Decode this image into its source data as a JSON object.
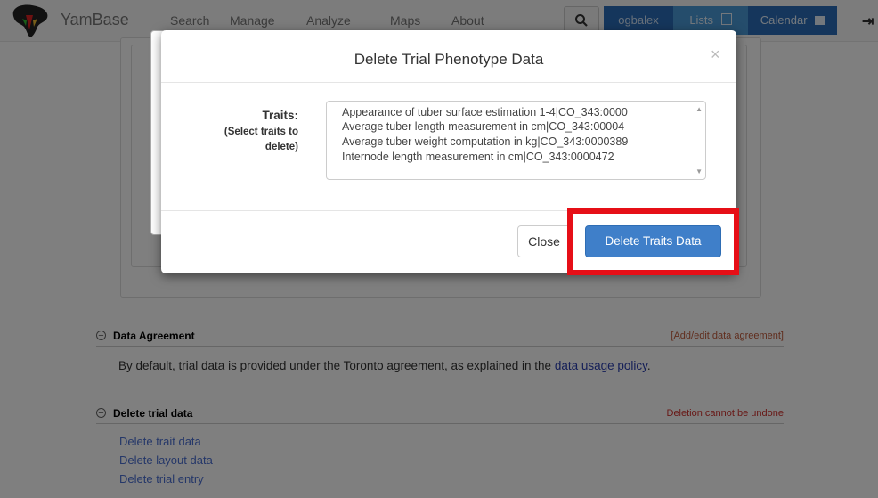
{
  "navbar": {
    "brand": "YamBase",
    "items": [
      "Search",
      "Manage",
      "Analyze",
      "Maps",
      "About"
    ],
    "user": "ogbalex",
    "lists": "Lists",
    "calendar": "Calendar"
  },
  "sections": {
    "agreement": {
      "title": "Data Agreement",
      "action": "[Add/edit data agreement]",
      "text": "By default, trial data is provided under the Toronto agreement, as explained in the ",
      "link": "data usage policy",
      "suffix": "."
    },
    "delete": {
      "title": "Delete trial data",
      "warning": "Deletion cannot be undone",
      "links": [
        "Delete trait data",
        "Delete layout data",
        "Delete trial entry"
      ]
    }
  },
  "modal": {
    "title": "Delete Trial Phenotype Data",
    "close_symbol": "×",
    "traits_label": "Traits:",
    "traits_hint": "(Select traits to delete)",
    "traits": [
      "Appearance of tuber surface estimation 1-4|CO_343:0000",
      "Average tuber length measurement in cm|CO_343:00004",
      "Average tuber weight computation in kg|CO_343:0000389",
      "Internode length measurement in cm|CO_343:0000472"
    ],
    "close_button": "Close",
    "delete_button": "Delete Traits Data"
  },
  "colors": {
    "primary": "#3f7fc9",
    "highlight": "#e60f17",
    "warning_text": "#d0312d",
    "link": "#4a6fd2"
  }
}
